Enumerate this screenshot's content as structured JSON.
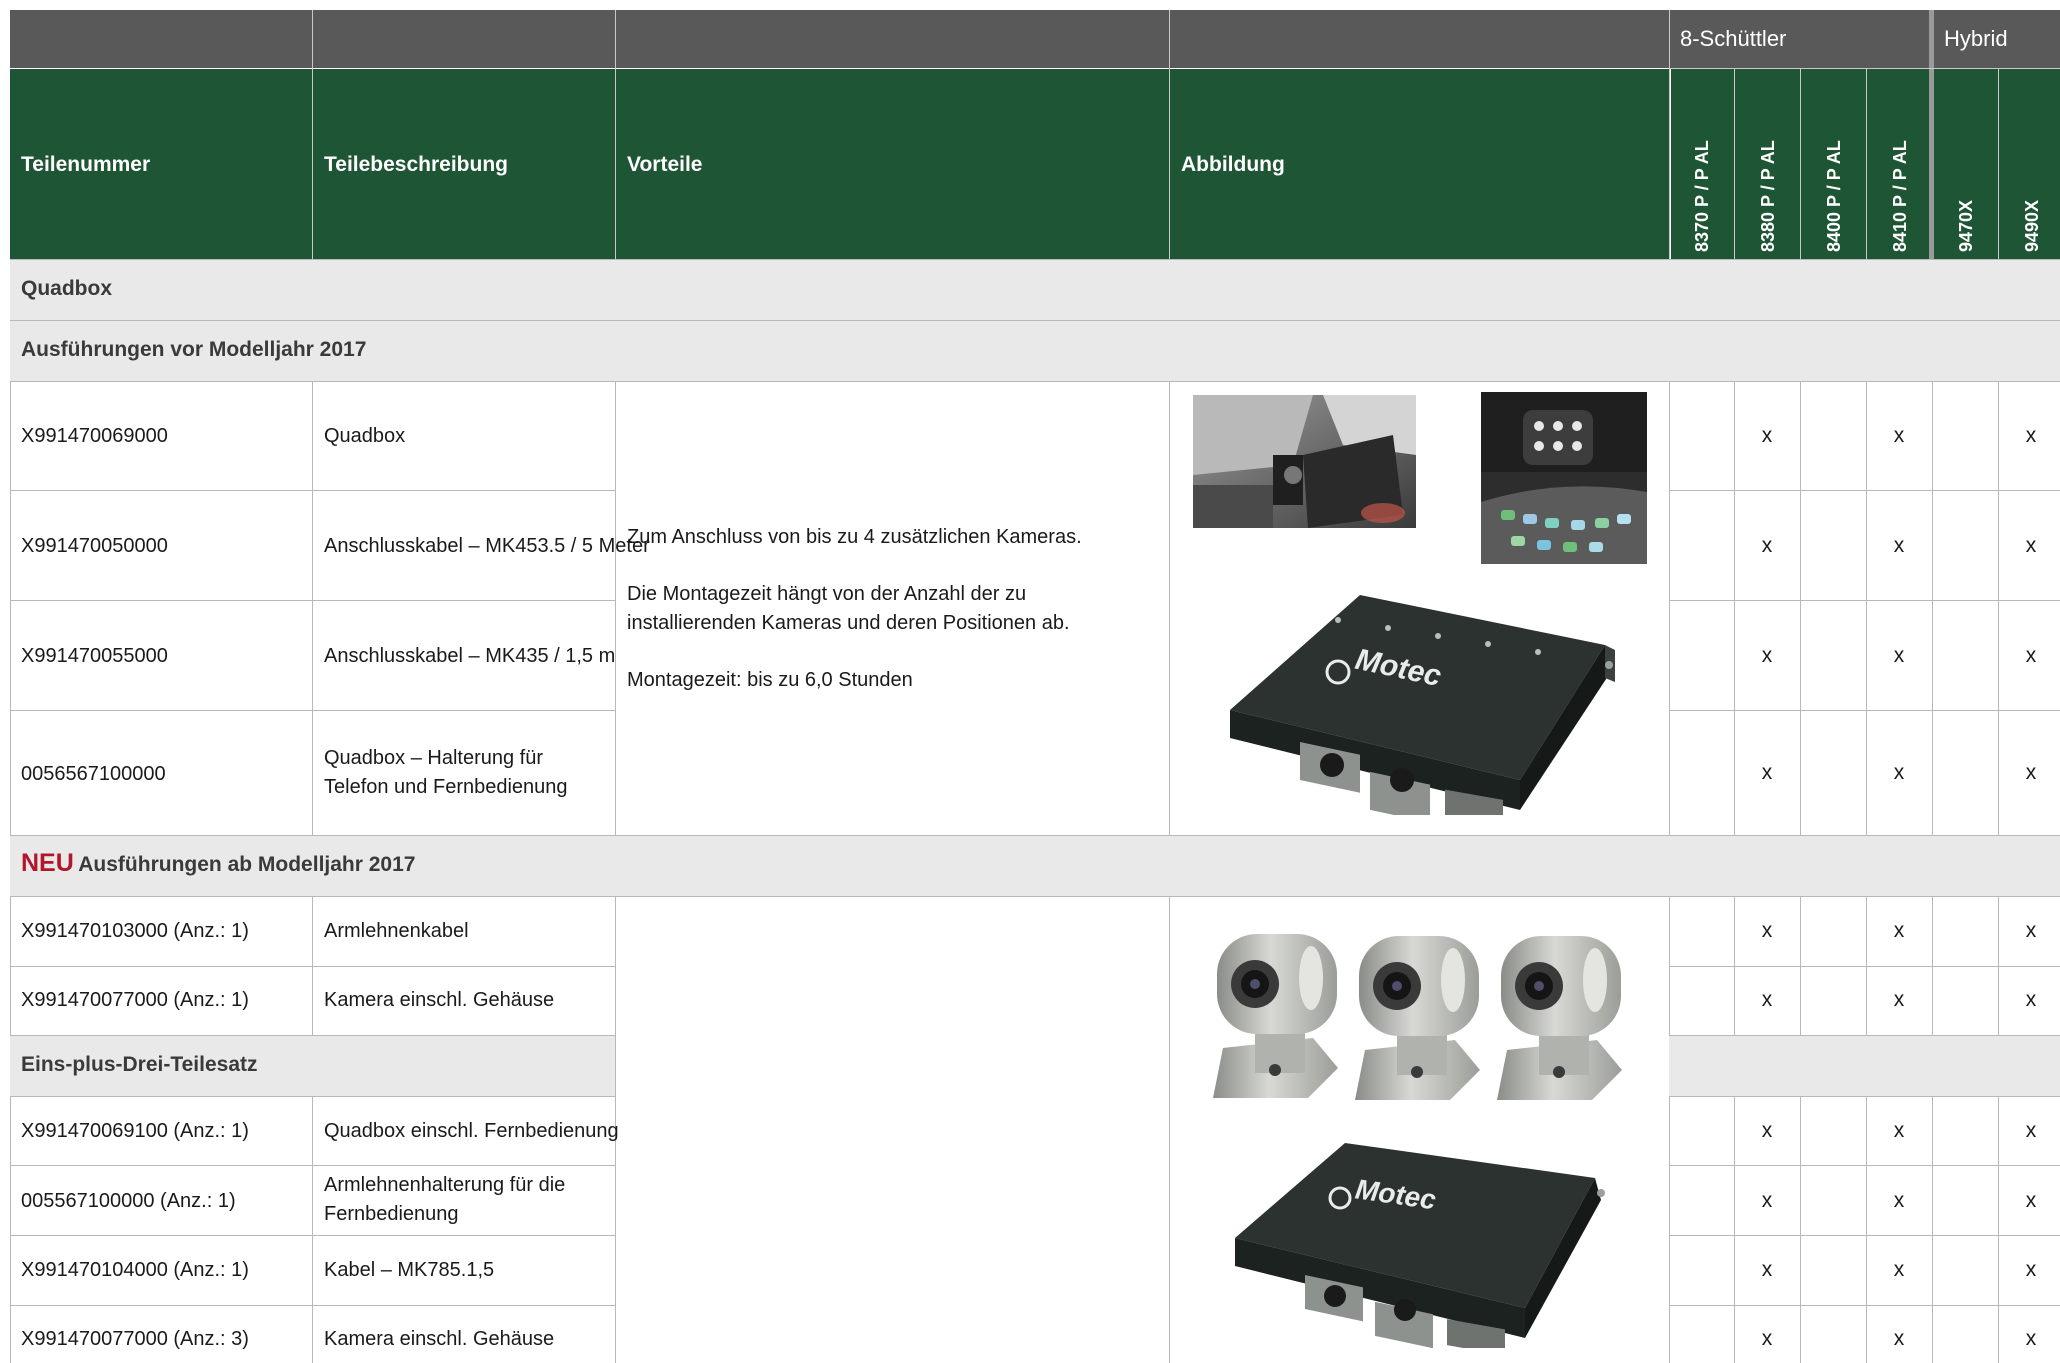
{
  "header": {
    "columns": [
      "Teilenummer",
      "Teilebeschreibung",
      "Vorteile",
      "Abbildung"
    ],
    "groups": [
      "8-Schüttler",
      "Hybrid"
    ],
    "models": [
      "8370 P / P AL",
      "8380 P / P AL",
      "8400 P / P AL",
      "8410 P / P AL",
      "9470X",
      "9490X"
    ]
  },
  "sections": {
    "quadbox": "Quadbox",
    "pre2017": "Ausführungen vor Modelljahr 2017",
    "new_badge": "NEU",
    "from2017": "Ausführungen ab Modelljahr 2017",
    "kit": "Eins-plus-Drei-Teilesatz"
  },
  "rows_pre2017": [
    {
      "part": "X991470069000",
      "desc": "Quadbox",
      "marks": [
        "",
        "x",
        "",
        "x",
        "",
        "x"
      ]
    },
    {
      "part": "X991470050000",
      "desc": "Anschlusskabel – MK453.5 / 5 Meter",
      "marks": [
        "",
        "x",
        "",
        "x",
        "",
        "x"
      ]
    },
    {
      "part": "X991470055000",
      "desc": "Anschlusskabel – MK435 / 1,5 m",
      "marks": [
        "",
        "x",
        "",
        "x",
        "",
        "x"
      ]
    },
    {
      "part": "0056567100000",
      "desc": "Quadbox – Halterung für Telefon und Fernbedienung",
      "marks": [
        "",
        "x",
        "",
        "x",
        "",
        "x"
      ]
    }
  ],
  "vorteile_pre2017": [
    "Zum Anschluss von bis zu 4 zusätzlichen Kameras.",
    "Die Montagezeit hängt von der Anzahl der zu installierenden Kameras und deren Positionen ab.",
    "Montagezeit: bis zu 6,0 Stunden"
  ],
  "rows_from2017": [
    {
      "part": "X991470103000 (Anz.: 1)",
      "desc": "Armlehnenkabel",
      "marks": [
        "",
        "x",
        "",
        "x",
        "",
        "x"
      ]
    },
    {
      "part": "X991470077000 (Anz.: 1)",
      "desc": "Kamera einschl. Gehäuse",
      "marks": [
        "",
        "x",
        "",
        "x",
        "",
        "x"
      ]
    }
  ],
  "rows_kit": [
    {
      "part": "X991470069100 (Anz.: 1)",
      "desc": "Quadbox einschl. Fernbedienung",
      "marks": [
        "",
        "x",
        "",
        "x",
        "",
        "x"
      ]
    },
    {
      "part": "005567100000 (Anz.: 1)",
      "desc": "Armlehnenhalterung für die Fernbedienung",
      "marks": [
        "",
        "x",
        "",
        "x",
        "",
        "x"
      ]
    },
    {
      "part": "X991470104000 (Anz.: 1)",
      "desc": "Kabel – MK785.1,5",
      "marks": [
        "",
        "x",
        "",
        "x",
        "",
        "x"
      ]
    },
    {
      "part": "X991470077000 (Anz.: 3)",
      "desc": "Kamera einschl. Gehäuse",
      "marks": [
        "",
        "x",
        "",
        "x",
        "",
        "x"
      ]
    }
  ],
  "images": {
    "logo_text": "Motec"
  }
}
